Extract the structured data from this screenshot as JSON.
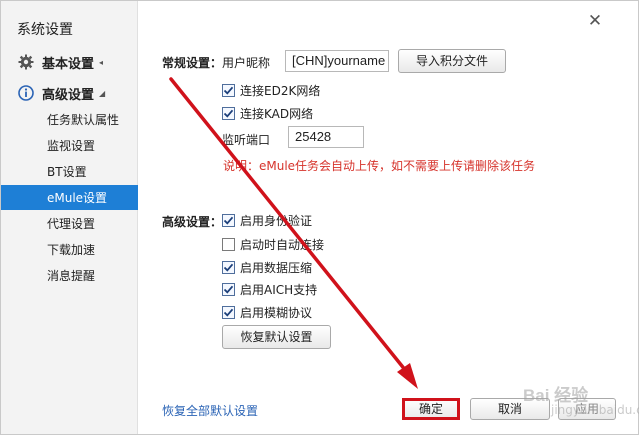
{
  "window": {
    "title": "系统设置",
    "close_icon": "close-icon"
  },
  "sidebar": {
    "groups": [
      {
        "label": "基本设置",
        "icon": "gear-icon",
        "caret": "◂"
      },
      {
        "label": "高级设置",
        "icon": "info-icon",
        "caret": "◢"
      }
    ],
    "items": [
      {
        "label": "任务默认属性",
        "active": false
      },
      {
        "label": "监视设置",
        "active": false
      },
      {
        "label": "BT设置",
        "active": false
      },
      {
        "label": "eMule设置",
        "active": true
      },
      {
        "label": "代理设置",
        "active": false
      },
      {
        "label": "下载加速",
        "active": false
      },
      {
        "label": "消息提醒",
        "active": false
      }
    ]
  },
  "main": {
    "general_section": {
      "title": "常规设置：",
      "nickname_label": "用户昵称",
      "nickname_value": "[CHN]yourname",
      "import_button": "导入积分文件",
      "checkboxes": [
        {
          "label": "连接ED2K网络",
          "checked": true
        },
        {
          "label": "连接KAD网络",
          "checked": true
        }
      ],
      "port_label": "监听端口",
      "port_value": "25428",
      "note": "说明：eMule任务会自动上传，如不需要上传请删除该任务"
    },
    "advanced_section": {
      "title": "高级设置：",
      "checkboxes": [
        {
          "label": "启用身份验证",
          "checked": true
        },
        {
          "label": "启动时自动连接",
          "checked": false
        },
        {
          "label": "启用数据压缩",
          "checked": true
        },
        {
          "label": "启用AICH支持",
          "checked": true
        },
        {
          "label": "启用模糊协议",
          "checked": true
        }
      ],
      "restore_default_button": "恢复默认设置"
    },
    "footer": {
      "restore_all_link": "恢复全部默认设置",
      "ok_button": "确定",
      "cancel_button": "取消",
      "apply_button": "应用"
    }
  },
  "watermark": {
    "text": "Bai 经验",
    "sub": "jingyan.baidu.com"
  },
  "colors": {
    "accent": "#1e7fd6",
    "note_red": "#d6332b",
    "annotation_red": "#d0121b",
    "link_blue": "#2a63b5"
  }
}
